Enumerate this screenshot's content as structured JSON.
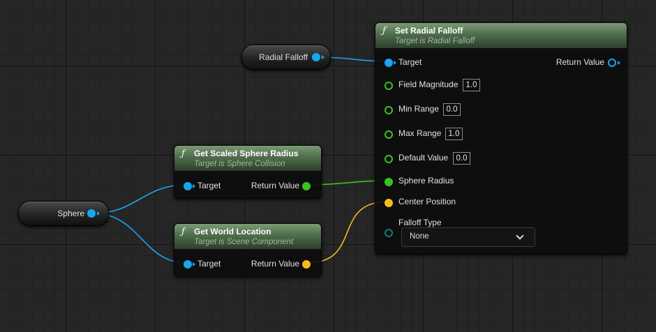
{
  "colors": {
    "object_pin": "#19a6f0",
    "float_pin": "#3bc21f",
    "vector_pin": "#f5bc1c",
    "enum_pin": "#0e7d76",
    "function_header": "#4f6d4c"
  },
  "variables": {
    "radial_falloff": {
      "label": "Radial Falloff"
    },
    "sphere": {
      "label": "Sphere"
    }
  },
  "nodes": {
    "set_radial_falloff": {
      "icon": "function-icon",
      "icon_glyph": "ƒ",
      "title": "Set Radial Falloff",
      "subtitle": "Target is Radial Falloff",
      "pins": {
        "target": "Target",
        "return_value": "Return Value",
        "field_magnitude": {
          "label": "Field Magnitude",
          "value": "1.0"
        },
        "min_range": {
          "label": "Min Range",
          "value": "0.0"
        },
        "max_range": {
          "label": "Max Range",
          "value": "1.0"
        },
        "default_value": {
          "label": "Default Value",
          "value": "0.0"
        },
        "sphere_radius": "Sphere Radius",
        "center_position": "Center Position",
        "falloff_type": {
          "label": "Falloff Type",
          "selected": "None"
        }
      }
    },
    "get_scaled_sphere_radius": {
      "icon": "function-icon",
      "icon_glyph": "ƒ",
      "title": "Get Scaled Sphere Radius",
      "subtitle": "Target is Sphere Collision",
      "pins": {
        "target": "Target",
        "return_value": "Return Value"
      }
    },
    "get_world_location": {
      "icon": "function-icon",
      "icon_glyph": "ƒ",
      "title": "Get World Location",
      "subtitle": "Target is Scene Component",
      "pins": {
        "target": "Target",
        "return_value": "Return Value"
      }
    }
  }
}
